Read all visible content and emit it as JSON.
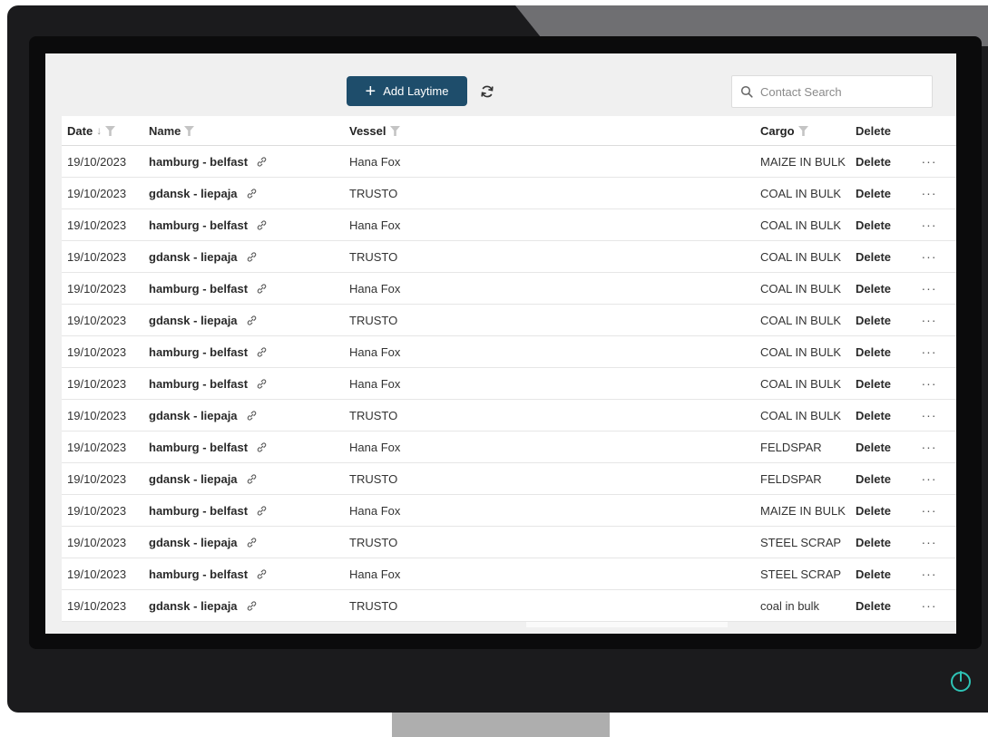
{
  "toolbar": {
    "add_label": "Add Laytime",
    "search_placeholder": "Contact Search",
    "icons": [
      "plus-icon",
      "refresh-icon",
      "search-icon"
    ]
  },
  "columns": {
    "date": "Date",
    "name": "Name",
    "vessel": "Vessel",
    "cargo": "Cargo",
    "delete": "Delete"
  },
  "rows": [
    {
      "date": "19/10/2023",
      "name": "hamburg - belfast",
      "vessel": "Hana Fox",
      "cargo": "MAIZE IN BULK",
      "delete": "Delete",
      "more": "···"
    },
    {
      "date": "19/10/2023",
      "name": "gdansk - liepaja",
      "vessel": "TRUSTO",
      "cargo": "COAL IN BULK",
      "delete": "Delete",
      "more": "···"
    },
    {
      "date": "19/10/2023",
      "name": "hamburg - belfast",
      "vessel": "Hana Fox",
      "cargo": "COAL IN BULK",
      "delete": "Delete",
      "more": "···"
    },
    {
      "date": "19/10/2023",
      "name": "gdansk - liepaja",
      "vessel": "TRUSTO",
      "cargo": "COAL IN BULK",
      "delete": "Delete",
      "more": "···"
    },
    {
      "date": "19/10/2023",
      "name": "hamburg - belfast",
      "vessel": "Hana Fox",
      "cargo": "COAL IN BULK",
      "delete": "Delete",
      "more": "···"
    },
    {
      "date": "19/10/2023",
      "name": "gdansk - liepaja",
      "vessel": "TRUSTO",
      "cargo": "COAL IN BULK",
      "delete": "Delete",
      "more": "···"
    },
    {
      "date": "19/10/2023",
      "name": "hamburg - belfast",
      "vessel": "Hana Fox",
      "cargo": "COAL IN BULK",
      "delete": "Delete",
      "more": "···"
    },
    {
      "date": "19/10/2023",
      "name": "hamburg - belfast",
      "vessel": "Hana Fox",
      "cargo": "COAL IN BULK",
      "delete": "Delete",
      "more": "···"
    },
    {
      "date": "19/10/2023",
      "name": "gdansk - liepaja",
      "vessel": "TRUSTO",
      "cargo": "COAL IN BULK",
      "delete": "Delete",
      "more": "···"
    },
    {
      "date": "19/10/2023",
      "name": "hamburg - belfast",
      "vessel": "Hana Fox",
      "cargo": "FELDSPAR",
      "delete": "Delete",
      "more": "···"
    },
    {
      "date": "19/10/2023",
      "name": "gdansk - liepaja",
      "vessel": "TRUSTO",
      "cargo": "FELDSPAR",
      "delete": "Delete",
      "more": "···"
    },
    {
      "date": "19/10/2023",
      "name": "hamburg - belfast",
      "vessel": "Hana Fox",
      "cargo": "MAIZE IN BULK",
      "delete": "Delete",
      "more": "···"
    },
    {
      "date": "19/10/2023",
      "name": "gdansk - liepaja",
      "vessel": "TRUSTO",
      "cargo": "STEEL SCRAP",
      "delete": "Delete",
      "more": "···"
    },
    {
      "date": "19/10/2023",
      "name": "hamburg - belfast",
      "vessel": "Hana Fox",
      "cargo": "STEEL SCRAP",
      "delete": "Delete",
      "more": "···"
    },
    {
      "date": "19/10/2023",
      "name": "gdansk - liepaja",
      "vessel": "TRUSTO",
      "cargo": "coal in bulk",
      "delete": "Delete",
      "more": "···"
    }
  ],
  "colors": {
    "accent": "#1e4d6b",
    "power": "#2ec4b6"
  }
}
